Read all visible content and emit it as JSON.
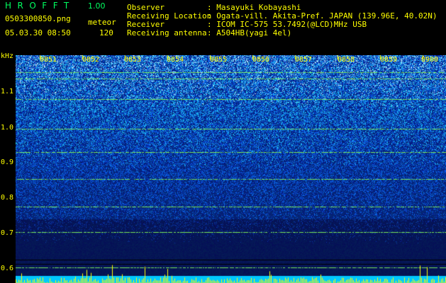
{
  "app": {
    "logo": "HROFFT",
    "version": "1.00"
  },
  "file": {
    "name": "0503300850.png",
    "datetime": "05.03.30 08:50",
    "mode_label": "meteor",
    "count": "120"
  },
  "info": {
    "observer_label": "Observer",
    "observer_value": ": Masayuki Kobayashi",
    "location_label": "Receiving Location",
    "location_value": ": Ogata-vill. Akita-Pref. JAPAN (139.96E, 40.02N)",
    "receiver_label": "Receiver",
    "receiver_value": ": ICOM IC-575 53.7492(@LCD)MHz USB",
    "antenna_label": "Receiving antenna",
    "antenna_value": ": A504HB(yagi 4el)"
  },
  "spectrogram": {
    "y_unit": "kHz",
    "y_ticks": [
      "1.1",
      "1.0",
      "0.9",
      "0.8",
      "0.7",
      "0.6"
    ],
    "x_ticks": [
      "0851",
      "0852",
      "0853",
      "0854",
      "0855",
      "0856",
      "0857",
      "0858",
      "0859",
      "0900"
    ],
    "colors": {
      "background": "#000000",
      "text": "#ffff00",
      "logo": "#00ff60",
      "noise_low": "#0a1a8c",
      "noise_high": "#40c0ff"
    }
  }
}
